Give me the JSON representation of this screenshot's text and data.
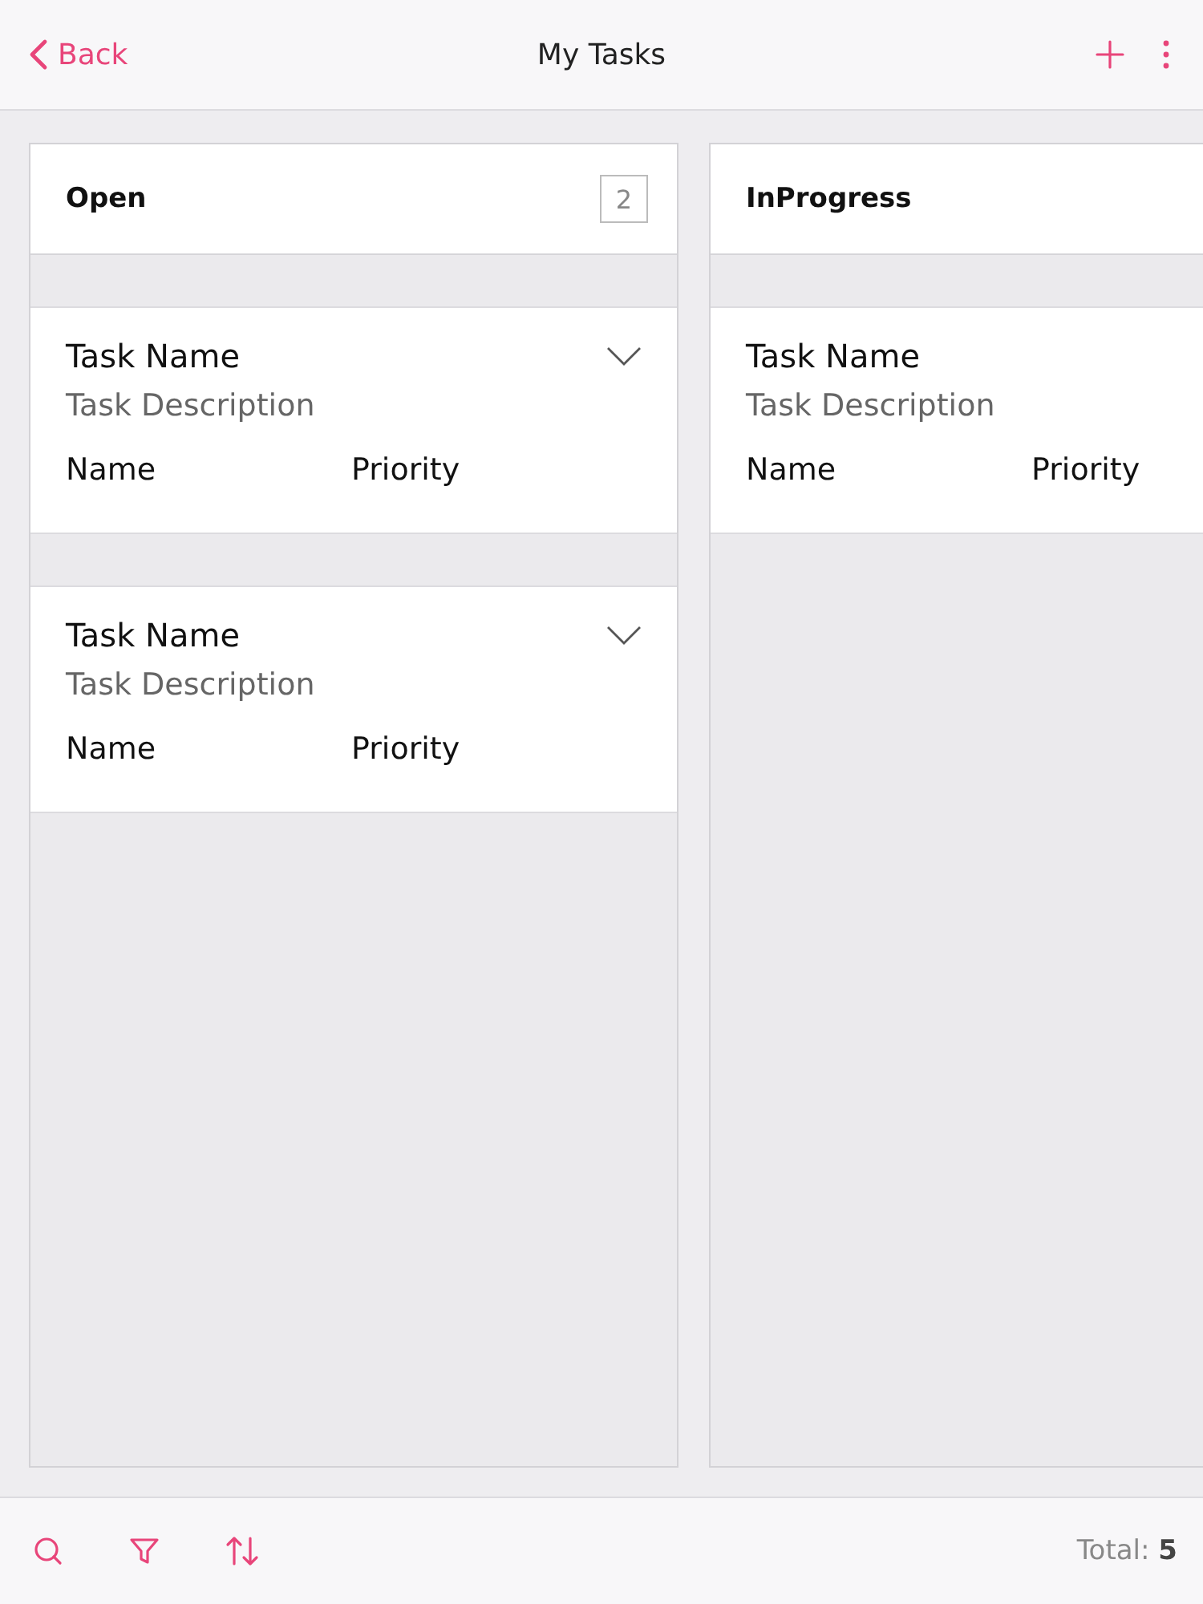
{
  "header": {
    "back": "Back",
    "title": "My Tasks"
  },
  "columns": [
    {
      "title": "Open",
      "count": "2",
      "cards": [
        {
          "name": "Task Name",
          "description": "Task Description",
          "assignee": "Name",
          "priority": "Priority",
          "chevron": true
        },
        {
          "name": "Task Name",
          "description": "Task Description",
          "assignee": "Name",
          "priority": "Priority",
          "chevron": true
        }
      ]
    },
    {
      "title": "InProgress",
      "cards": [
        {
          "name": "Task Name",
          "description": "Task Description",
          "assignee": "Name",
          "priority": "Priority"
        }
      ]
    }
  ],
  "footer": {
    "total": "Total: **5**"
  }
}
